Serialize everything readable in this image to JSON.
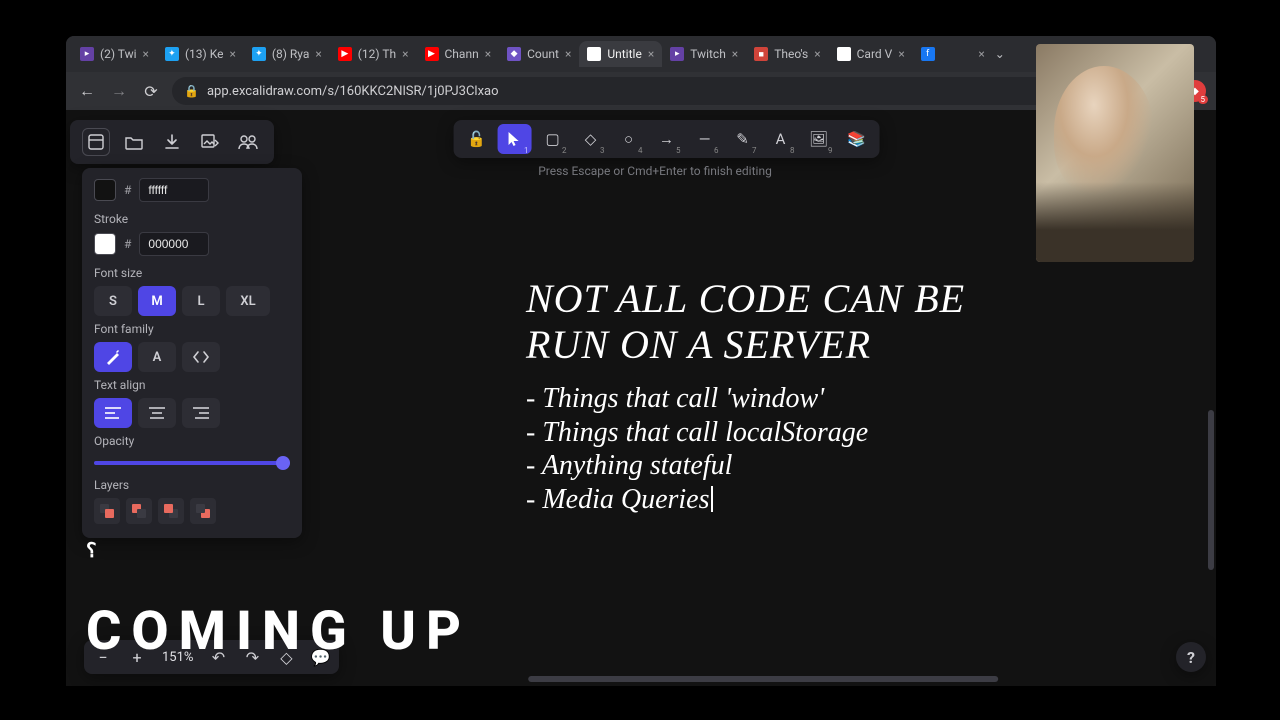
{
  "tabs": [
    {
      "favicon_bg": "#6441a5",
      "favicon_txt": "▸",
      "label": "(2) Twi",
      "active": false
    },
    {
      "favicon_bg": "#1da1f2",
      "favicon_txt": "✦",
      "label": "(13) Ke",
      "active": false
    },
    {
      "favicon_bg": "#1da1f2",
      "favicon_txt": "✦",
      "label": "(8) Rya",
      "active": false
    },
    {
      "favicon_bg": "#ff0000",
      "favicon_txt": "▶",
      "label": "(12) Th",
      "active": false
    },
    {
      "favicon_bg": "#ff0000",
      "favicon_txt": "▶",
      "label": "Chann",
      "active": false
    },
    {
      "favicon_bg": "#6f53c4",
      "favicon_txt": "◆",
      "label": "Count",
      "active": false
    },
    {
      "favicon_bg": "#ffffff",
      "favicon_txt": "✎",
      "label": "Untitle",
      "active": true
    },
    {
      "favicon_bg": "#6441a5",
      "favicon_txt": "▸",
      "label": "Twitch",
      "active": false
    },
    {
      "favicon_bg": "#d0443a",
      "favicon_txt": "■",
      "label": "Theo's",
      "active": false
    },
    {
      "favicon_bg": "#ffffff",
      "favicon_txt": "◧",
      "label": "Card V",
      "active": false
    },
    {
      "favicon_bg": "#1877f2",
      "favicon_txt": "f",
      "label": "",
      "active": false
    }
  ],
  "url": "app.excalidraw.com/s/160KKC2NlSR/1j0PJ3Clxao",
  "hint": "Press Escape or Cmd+Enter to finish editing",
  "shape_tools": [
    {
      "key": "lock",
      "num": "",
      "icon": "🔓"
    },
    {
      "key": "select",
      "num": "1",
      "icon": "cursor"
    },
    {
      "key": "rect",
      "num": "2",
      "icon": "▢"
    },
    {
      "key": "diamond",
      "num": "3",
      "icon": "◇"
    },
    {
      "key": "ellipse",
      "num": "4",
      "icon": "○"
    },
    {
      "key": "arrow",
      "num": "5",
      "icon": "→"
    },
    {
      "key": "line",
      "num": "6",
      "icon": "—"
    },
    {
      "key": "draw",
      "num": "7",
      "icon": "✎"
    },
    {
      "key": "text",
      "num": "8",
      "icon": "A"
    },
    {
      "key": "image",
      "num": "9",
      "icon": "🖼"
    },
    {
      "key": "library",
      "num": "",
      "icon": "📚"
    }
  ],
  "active_shape": "select",
  "panel": {
    "fill_hex": "ffffff",
    "stroke_label": "Stroke",
    "stroke_hex": "000000",
    "fontsize_label": "Font size",
    "sizes": [
      "S",
      "M",
      "L",
      "XL"
    ],
    "active_size": "M",
    "fontfamily_label": "Font family",
    "textalign_label": "Text align",
    "opacity_label": "Opacity",
    "opacity_value": 100,
    "layers_label": "Layers"
  },
  "canvas": {
    "heading_l1": "NOT ALL CODE CAN BE",
    "heading_l2": "RUN ON A SERVER",
    "bullets": [
      "- Things that call 'window'",
      "- Things that call localStorage",
      "- Anything stateful",
      "- Media Queries"
    ]
  },
  "zoom": "151%",
  "overlay": {
    "coming_up": "COMING UP"
  }
}
